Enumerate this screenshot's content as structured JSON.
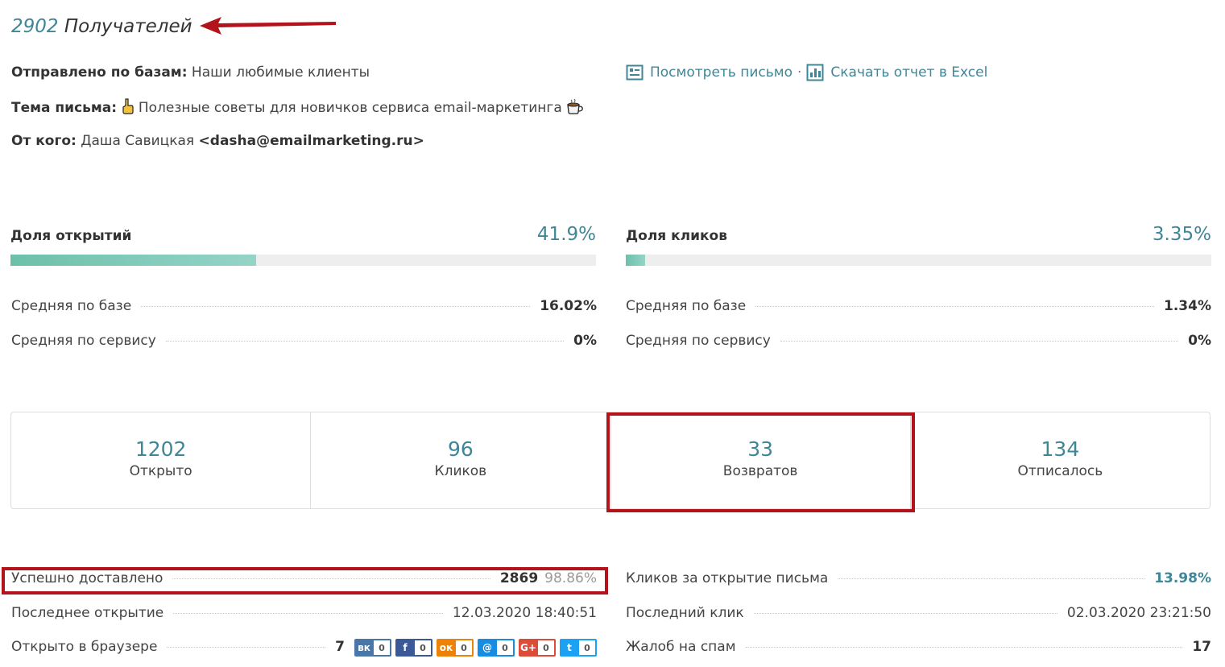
{
  "header": {
    "recipients_count": "2902",
    "recipients_label": "Получателей"
  },
  "meta": {
    "bases_label": "Отправлено по базам:",
    "bases_value": "Наши любимые клиенты",
    "subject_label": "Тема письма:",
    "subject_value": "Полезные советы для новичков сервиса email-маркетинга",
    "from_label": "От кого:",
    "from_name": "Даша Савицкая",
    "from_email": "<dasha@emailmarketing.ru>"
  },
  "actions": {
    "view_letter": "Посмотреть письмо",
    "separator": "·",
    "download_excel": "Скачать отчет в Excel"
  },
  "open_rate": {
    "title": "Доля открытий",
    "value": "41.9%",
    "fraction": 0.419,
    "avg_base_label": "Средняя по базе",
    "avg_base_value": "16.02%",
    "avg_service_label": "Средняя по сервису",
    "avg_service_value": "0%"
  },
  "click_rate": {
    "title": "Доля кликов",
    "value": "3.35%",
    "fraction": 0.0335,
    "avg_base_label": "Средняя по базе",
    "avg_base_value": "1.34%",
    "avg_service_label": "Средняя по сервису",
    "avg_service_value": "0%"
  },
  "stats": [
    {
      "value": "1202",
      "label": "Открыто"
    },
    {
      "value": "96",
      "label": "Кликов"
    },
    {
      "value": "33",
      "label": "Возвратов"
    },
    {
      "value": "134",
      "label": "Отписалось"
    }
  ],
  "details_left": {
    "delivered_label": "Успешно доставлено",
    "delivered_value": "2869",
    "delivered_pct": "98.86%",
    "last_open_label": "Последнее открытие",
    "last_open_value": "12.03.2020 18:40:51",
    "browser_label": "Открыто в браузере",
    "browser_value": "7"
  },
  "details_right": {
    "clicks_per_open_label": "Кликов за открытие письма",
    "clicks_per_open_value": "13.98%",
    "last_click_label": "Последний клик",
    "last_click_value": "02.03.2020 23:21:50",
    "spam_label": "Жалоб на спам",
    "spam_value": "17"
  },
  "social": [
    {
      "icon": "vk-icon",
      "glyph": "вк",
      "count": "0",
      "color": "#4a76a8"
    },
    {
      "icon": "facebook-icon",
      "glyph": "f",
      "count": "0",
      "color": "#3b5998"
    },
    {
      "icon": "odnoklassniki-icon",
      "glyph": "ок",
      "count": "0",
      "color": "#ee8208"
    },
    {
      "icon": "moimir-icon",
      "glyph": "@",
      "count": "0",
      "color": "#168de2"
    },
    {
      "icon": "googleplus-icon",
      "glyph": "G+",
      "count": "0",
      "color": "#dd4b39"
    },
    {
      "icon": "twitter-icon",
      "glyph": "t",
      "count": "0",
      "color": "#1da1f2"
    }
  ],
  "colors": {
    "accent": "#3f8796",
    "bar_fill": "#6cc0aa",
    "annotation": "#b3141c"
  }
}
